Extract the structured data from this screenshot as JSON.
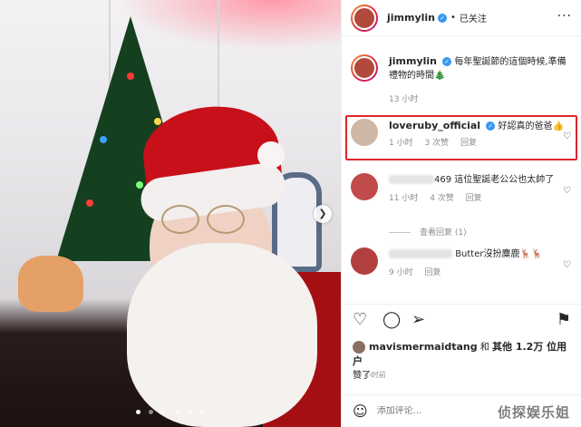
{
  "header": {
    "username": "jimmylin",
    "separator": "•",
    "follow_status": "已关注",
    "more_icon": "more-horizontal-icon"
  },
  "caption": {
    "username": "jimmylin",
    "text": "每年聖誕節的這個時候,準備禮物的時間🎄",
    "time": "13 小时"
  },
  "comments": [
    {
      "username": "loveruby_official",
      "verified": true,
      "text": "好認真的爸爸👍",
      "time": "1 小时",
      "likes": "3 次赞",
      "reply": "回复"
    },
    {
      "username_partial": "469",
      "text": "這位聖誕老公公也太帥了",
      "time": "11 小时",
      "likes": "4 次赞",
      "reply": "回复"
    },
    {
      "text": "Butter沒扮麋鹿🦌🦌",
      "time": "9 小时",
      "reply": "回复"
    }
  ],
  "view_replies": "查看回复 (1)",
  "likes_text": {
    "user": "mavismermaidtang",
    "mid": "和",
    "others": "其他 1.2万 位用户",
    "tail": "赞了"
  },
  "post_time": "13 小时前",
  "add_comment": {
    "placeholder": "添加评论..."
  },
  "watermark": "侦探娱乐姐",
  "photo": {
    "carousel_dots": 6,
    "active_dot": 0
  },
  "colors": {
    "verified": "#3897f0",
    "highlight_border": "#e0242a",
    "muted_text": "#8e8e8e"
  }
}
